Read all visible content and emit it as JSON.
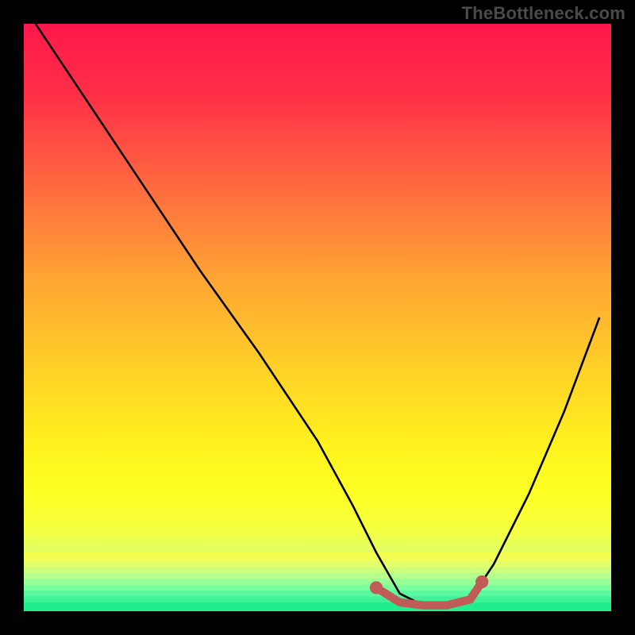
{
  "attribution": "TheBottleneck.com",
  "chart_data": {
    "type": "line",
    "title": "",
    "xlabel": "",
    "ylabel": "",
    "xlim": [
      0,
      100
    ],
    "ylim": [
      0,
      100
    ],
    "grid": false,
    "series": [
      {
        "name": "bottleneck-curve",
        "x": [
          2,
          10,
          20,
          30,
          40,
          50,
          56,
          60,
          64,
          68,
          72,
          76,
          80,
          86,
          92,
          98
        ],
        "values": [
          100,
          88,
          73,
          58,
          44,
          29,
          18,
          10,
          3,
          1,
          1,
          2,
          8,
          20,
          34,
          50
        ],
        "stroke": "#000000"
      },
      {
        "name": "optimal-segment",
        "x": [
          60,
          64,
          68,
          72,
          76,
          78
        ],
        "values": [
          4,
          1.5,
          1,
          1,
          2,
          5
        ],
        "stroke": "#c15b57"
      }
    ],
    "annotations": [
      {
        "name": "left-endpoint-dot",
        "x": 60,
        "y": 4,
        "color": "#c15b57"
      },
      {
        "name": "right-endpoint-dot",
        "x": 78,
        "y": 5,
        "color": "#c15b57"
      }
    ],
    "background_gradient": {
      "direction": "vertical",
      "stops": [
        {
          "offset": 0.0,
          "color": "#ff184a"
        },
        {
          "offset": 0.12,
          "color": "#ff2f47"
        },
        {
          "offset": 0.28,
          "color": "#ff6b3f"
        },
        {
          "offset": 0.44,
          "color": "#ffa733"
        },
        {
          "offset": 0.6,
          "color": "#ffd426"
        },
        {
          "offset": 0.72,
          "color": "#fff21e"
        },
        {
          "offset": 0.8,
          "color": "#fdff23"
        },
        {
          "offset": 0.86,
          "color": "#f4ff3e"
        },
        {
          "offset": 0.9,
          "color": "#e2ff66"
        },
        {
          "offset": 0.94,
          "color": "#b9ff8a"
        },
        {
          "offset": 0.97,
          "color": "#7effa1"
        },
        {
          "offset": 1.0,
          "color": "#1cf08d"
        }
      ]
    },
    "green_bands": [
      {
        "y0": 0.9,
        "y1": 0.905,
        "color": "#f9ff47"
      },
      {
        "y0": 0.905,
        "y1": 0.915,
        "color": "#efff56"
      },
      {
        "y0": 0.915,
        "y1": 0.925,
        "color": "#e0ff6b"
      },
      {
        "y0": 0.925,
        "y1": 0.935,
        "color": "#cdff7d"
      },
      {
        "y0": 0.935,
        "y1": 0.945,
        "color": "#b5ff8c"
      },
      {
        "y0": 0.945,
        "y1": 0.955,
        "color": "#98ff97"
      },
      {
        "y0": 0.955,
        "y1": 0.965,
        "color": "#79ff9e"
      },
      {
        "y0": 0.965,
        "y1": 0.975,
        "color": "#5af8a0"
      },
      {
        "y0": 0.975,
        "y1": 0.985,
        "color": "#40f297"
      },
      {
        "y0": 0.985,
        "y1": 1.0,
        "color": "#20ee8c"
      }
    ]
  }
}
